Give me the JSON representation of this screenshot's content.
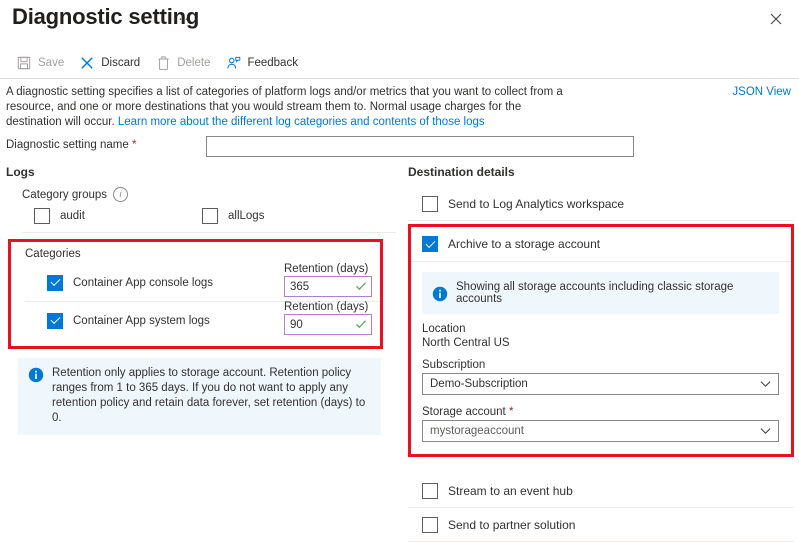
{
  "header": {
    "title": "Diagnostic setting",
    "ellipsis": "···",
    "close_icon": "close-icon"
  },
  "commandbar": {
    "items": [
      {
        "label": "Save",
        "icon": "save-icon",
        "enabled": false
      },
      {
        "label": "Discard",
        "icon": "discard-x-icon",
        "enabled": true
      },
      {
        "label": "Delete",
        "icon": "trash-icon",
        "enabled": false
      },
      {
        "label": "Feedback",
        "icon": "feedback-person-icon",
        "enabled": true
      }
    ]
  },
  "description": {
    "part1": "A diagnostic setting specifies a list of categories of platform logs and/or metrics that you want to collect from a resource, and one or more destinations that you would stream them to. Normal usage charges for the destination will occur. ",
    "link": "Learn more about the different log categories and contents of those logs",
    "json_view": "JSON View"
  },
  "name_field": {
    "label": "Diagnostic setting name ",
    "required_marker": "*",
    "value": "",
    "placeholder": ""
  },
  "logs": {
    "section_title": "Logs",
    "category_groups": {
      "label": "Category groups",
      "info_icon": "info-icon",
      "items": [
        {
          "label": "audit",
          "checked": false
        },
        {
          "label": "allLogs",
          "checked": false
        }
      ]
    },
    "categories": {
      "title": "Categories",
      "items": [
        {
          "label": "Container App console logs",
          "checked": true,
          "retention_label": "Retention (days)",
          "retention_value": "365"
        },
        {
          "label": "Container App system logs",
          "checked": true,
          "retention_label": "Retention (days)",
          "retention_value": "90"
        }
      ]
    },
    "retention_notice": "Retention only applies to storage account. Retention policy ranges from 1 to 365 days. If you do not want to apply any retention policy and retain data forever, set retention (days) to 0."
  },
  "destination": {
    "section_title": "Destination details",
    "log_analytics": {
      "label": "Send to Log Analytics workspace",
      "checked": false
    },
    "archive": {
      "label": "Archive to a storage account",
      "checked": true,
      "banner": "Showing all storage accounts including classic storage accounts",
      "location_label": "Location",
      "location_value": "North Central US",
      "subscription_label": "Subscription",
      "subscription_value": "Demo-Subscription",
      "storage_label": "Storage account ",
      "storage_required_marker": "*",
      "storage_value": "mystorageaccount"
    },
    "event_hub": {
      "label": "Stream to an event hub",
      "checked": false
    },
    "partner": {
      "label": "Send to partner solution",
      "checked": false
    }
  },
  "colors": {
    "accent": "#0078d4",
    "highlight_red": "#e81123",
    "retention_border": "#b07fc7",
    "valid_check_green": "#5ea75e",
    "banner_bg": "#eff6fc",
    "required_red": "#a4262c"
  }
}
